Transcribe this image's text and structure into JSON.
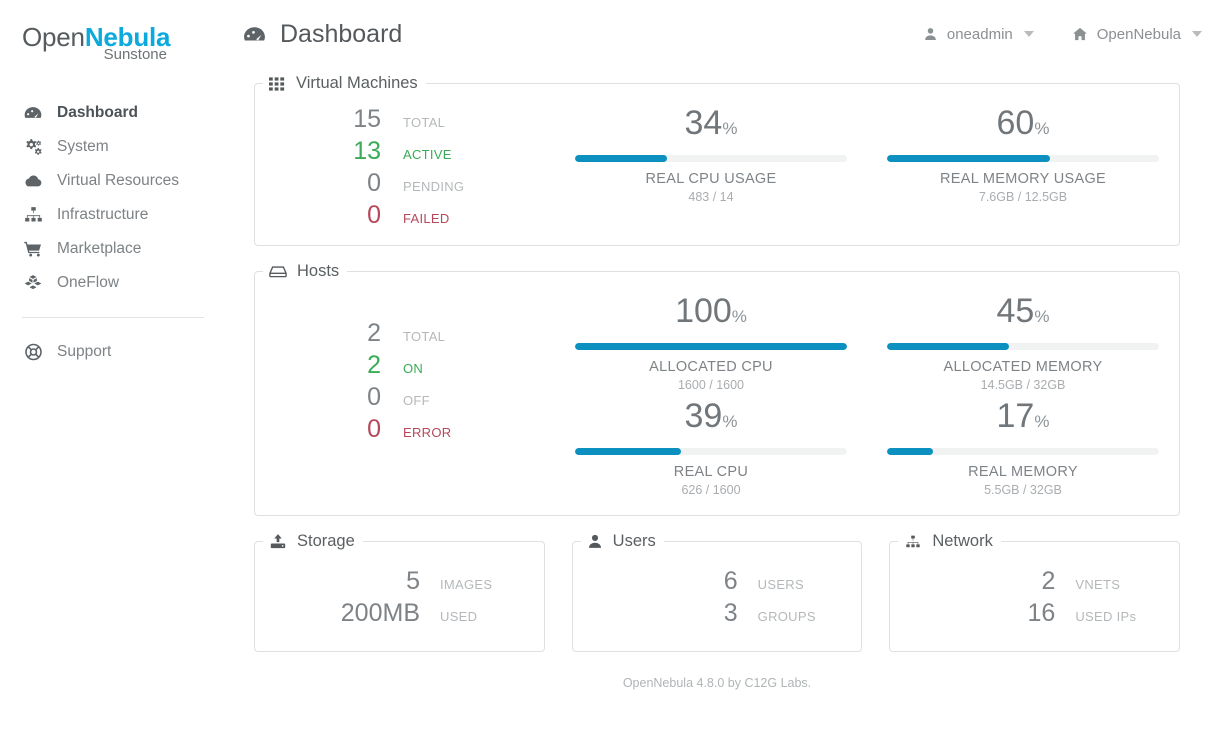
{
  "brand": {
    "logo_open": "Open",
    "logo_nebula": "Nebula",
    "logo_sub": "Sunstone",
    "accent_blue": "#0ca9dd",
    "bar_blue": "#0c90c0",
    "green": "#3aab56",
    "red": "#b5485a"
  },
  "sidebar": {
    "items": [
      {
        "label": "Dashboard",
        "icon": "dashboard-icon",
        "active": true
      },
      {
        "label": "System",
        "icon": "gears-icon",
        "active": false
      },
      {
        "label": "Virtual Resources",
        "icon": "cloud-icon",
        "active": false
      },
      {
        "label": "Infrastructure",
        "icon": "sitemap-icon",
        "active": false
      },
      {
        "label": "Marketplace",
        "icon": "shopping-cart-icon",
        "active": false
      },
      {
        "label": "OneFlow",
        "icon": "cubes-icon",
        "active": false
      }
    ],
    "support": {
      "label": "Support",
      "icon": "lifebuoy-icon"
    }
  },
  "header": {
    "title": "Dashboard",
    "title_icon": "dashboard-icon",
    "user_menu": {
      "label": "oneadmin",
      "icon": "user-icon"
    },
    "zone_menu": {
      "label": "OpenNebula",
      "icon": "home-icon"
    }
  },
  "panels": {
    "virtual_machines": {
      "title": "Virtual Machines",
      "icon": "grid-icon",
      "counters": [
        {
          "value": "15",
          "label": "TOTAL",
          "tone": "gray"
        },
        {
          "value": "13",
          "label": "ACTIVE",
          "tone": "green"
        },
        {
          "value": "0",
          "label": "PENDING",
          "tone": "muted"
        },
        {
          "value": "0",
          "label": "FAILED",
          "tone": "red"
        }
      ],
      "gauges": [
        {
          "value": "34",
          "pct": "%",
          "percent": 34,
          "name": "REAL CPU USAGE",
          "sub": "483 / 14"
        },
        {
          "value": "60",
          "pct": "%",
          "percent": 60,
          "name": "REAL MEMORY USAGE",
          "sub": "7.6GB / 12.5GB"
        }
      ]
    },
    "hosts": {
      "title": "Hosts",
      "icon": "server-icon",
      "counters": [
        {
          "value": "2",
          "label": "TOTAL",
          "tone": "gray"
        },
        {
          "value": "2",
          "label": "ON",
          "tone": "green"
        },
        {
          "value": "0",
          "label": "OFF",
          "tone": "muted"
        },
        {
          "value": "0",
          "label": "ERROR",
          "tone": "red"
        }
      ],
      "gauges_cpu": [
        {
          "value": "100",
          "pct": "%",
          "percent": 100,
          "name": "ALLOCATED CPU",
          "sub": "1600 / 1600"
        },
        {
          "value": "39",
          "pct": "%",
          "percent": 39,
          "name": "REAL CPU",
          "sub": "626 / 1600"
        }
      ],
      "gauges_mem": [
        {
          "value": "45",
          "pct": "%",
          "percent": 45,
          "name": "ALLOCATED MEMORY",
          "sub": "14.5GB / 32GB"
        },
        {
          "value": "17",
          "pct": "%",
          "percent": 17,
          "name": "REAL MEMORY",
          "sub": "5.5GB / 32GB"
        }
      ]
    },
    "storage": {
      "title": "Storage",
      "icon": "hdd-upload-icon",
      "rows": [
        {
          "value": "5",
          "label": "IMAGES"
        },
        {
          "value": "200MB",
          "label": "USED"
        }
      ]
    },
    "users": {
      "title": "Users",
      "icon": "user-icon",
      "rows": [
        {
          "value": "6",
          "label": "USERS"
        },
        {
          "value": "3",
          "label": "GROUPS"
        }
      ]
    },
    "network": {
      "title": "Network",
      "icon": "sitemap-icon",
      "rows": [
        {
          "value": "2",
          "label": "VNETS"
        },
        {
          "value": "16",
          "label": "USED IPs"
        }
      ]
    }
  },
  "footer": {
    "text": "OpenNebula 4.8.0 by C12G Labs."
  }
}
